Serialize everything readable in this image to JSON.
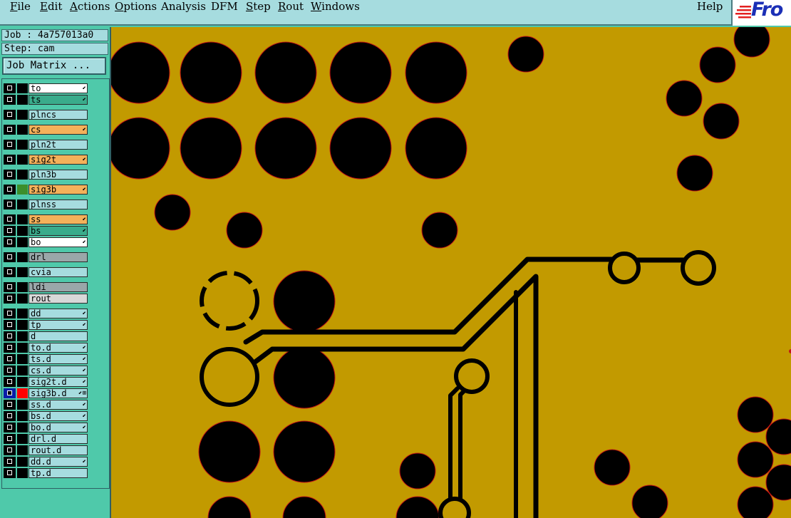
{
  "menu": {
    "items": [
      {
        "label": "File",
        "ul": "F",
        "rest": "ile"
      },
      {
        "label": "Edit",
        "ul": "E",
        "rest": "dit"
      },
      {
        "label": "Actions",
        "ul": "A",
        "rest": "ctions"
      },
      {
        "label": "Options",
        "ul": "O",
        "rest": "ptions"
      },
      {
        "label": "Analysis",
        "ul": "",
        "rest": "Analysis"
      },
      {
        "label": "DFM",
        "ul": "",
        "rest": "DFM"
      },
      {
        "label": "Step",
        "ul": "S",
        "rest": "tep"
      },
      {
        "label": "Rout",
        "ul": "R",
        "rest": "out"
      },
      {
        "label": "Windows",
        "ul": "W",
        "rest": "indows"
      },
      {
        "label": "Help",
        "ul": "",
        "rest": "Help"
      }
    ],
    "logo_text": "Fro"
  },
  "info": {
    "job": "Job : 4a757013a0",
    "step": "Step: cam",
    "job_matrix_button": "Job Matrix ..."
  },
  "colors": {
    "board": "#c29a00",
    "copper_void": "#000000",
    "panel_bg": "#4fc9aa",
    "menu_bg": "#a6dcdf",
    "layer_white": "#ffffff",
    "layer_green": "#3aab8b",
    "layer_orange": "#f4b15a",
    "layer_cyan": "#a6dcdf",
    "layer_gray": "#9aa7a9",
    "layer_lightgray": "#d8d8d8",
    "selected_red": "#ff0000"
  },
  "layers": [
    {
      "name": "to",
      "bg": "#ffffff",
      "mark": "⬋",
      "group": 0
    },
    {
      "name": "ts",
      "bg": "#3aab8b",
      "mark": "⬋",
      "group": 0
    },
    {
      "name": "plncs",
      "bg": "#a6dcdf",
      "mark": "",
      "group": 1
    },
    {
      "name": "cs",
      "bg": "#f4b15a",
      "mark": "⬋",
      "group": 2
    },
    {
      "name": "pln2t",
      "bg": "#a6dcdf",
      "mark": "",
      "group": 3
    },
    {
      "name": "sig2t",
      "bg": "#f4b15a",
      "mark": "⬋",
      "group": 4
    },
    {
      "name": "pln3b",
      "bg": "#a6dcdf",
      "mark": "",
      "group": 5
    },
    {
      "name": "sig3b",
      "bg": "#f4b15a",
      "mark": "⬋",
      "group": 6,
      "swatch": "#3c8f2c"
    },
    {
      "name": "plnss",
      "bg": "#a6dcdf",
      "mark": "",
      "group": 7
    },
    {
      "name": "ss",
      "bg": "#f4b15a",
      "mark": "⬋",
      "group": 8
    },
    {
      "name": "bs",
      "bg": "#3aab8b",
      "mark": "⬋",
      "group": 8
    },
    {
      "name": "bo",
      "bg": "#ffffff",
      "mark": "⬋",
      "group": 8
    },
    {
      "name": "drl",
      "bg": "#9aa7a9",
      "mark": "",
      "group": 9
    },
    {
      "name": "cvia",
      "bg": "#a6dcdf",
      "mark": "",
      "group": 10
    },
    {
      "name": "ldi",
      "bg": "#9aa7a9",
      "mark": "",
      "group": 11
    },
    {
      "name": "rout",
      "bg": "#d8d8d8",
      "mark": "",
      "group": 11
    },
    {
      "name": "dd",
      "bg": "#a6dcdf",
      "mark": "⬋",
      "group": 12
    },
    {
      "name": "tp",
      "bg": "#a6dcdf",
      "mark": "⬋",
      "group": 12
    },
    {
      "name": "d",
      "bg": "#a6dcdf",
      "mark": "",
      "group": 12
    },
    {
      "name": "to.d",
      "bg": "#a6dcdf",
      "mark": "⬋",
      "group": 12
    },
    {
      "name": "ts.d",
      "bg": "#a6dcdf",
      "mark": "⬋",
      "group": 12
    },
    {
      "name": "cs.d",
      "bg": "#a6dcdf",
      "mark": "⬋",
      "group": 12
    },
    {
      "name": "sig2t.d",
      "bg": "#a6dcdf",
      "mark": "⬋",
      "group": 12
    },
    {
      "name": "sig3b.d",
      "bg": "#a6dcdf",
      "mark": "⬋⊞",
      "group": 12,
      "selected": true,
      "swatch": "#ff0000"
    },
    {
      "name": "ss.d",
      "bg": "#a6dcdf",
      "mark": "⬋",
      "group": 12
    },
    {
      "name": "bs.d",
      "bg": "#a6dcdf",
      "mark": "⬋",
      "group": 12
    },
    {
      "name": "bo.d",
      "bg": "#a6dcdf",
      "mark": "⬋",
      "group": 12
    },
    {
      "name": "drl.d",
      "bg": "#a6dcdf",
      "mark": "",
      "group": 12
    },
    {
      "name": "rout.d",
      "bg": "#a6dcdf",
      "mark": "",
      "group": 12
    },
    {
      "name": "dd.d",
      "bg": "#a6dcdf",
      "mark": "⬋",
      "group": 12
    },
    {
      "name": "tp.d",
      "bg": "#a6dcdf",
      "mark": "",
      "group": 12
    }
  ]
}
